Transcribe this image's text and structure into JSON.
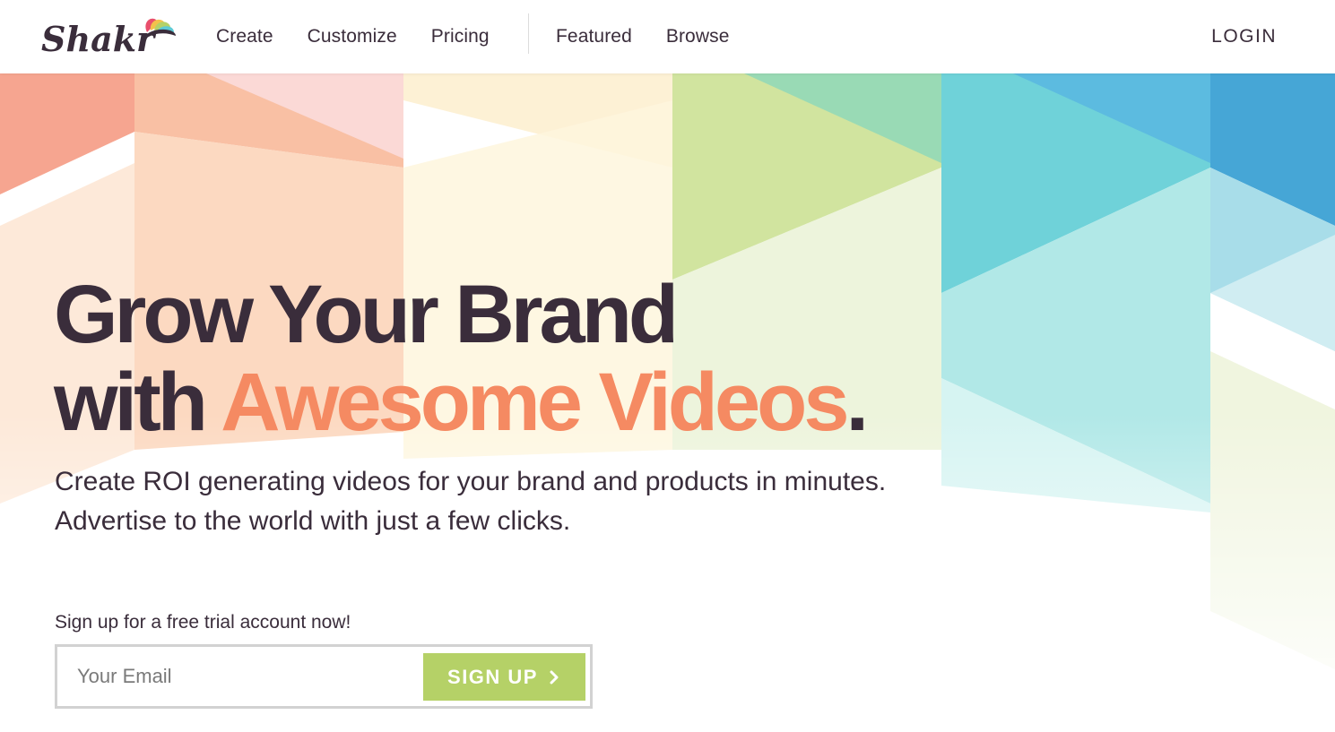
{
  "brand": {
    "logo_text": "Shakr",
    "logo_colors": [
      "#f58a62",
      "#f3c24c",
      "#b5d167",
      "#5ccad6",
      "#3aa0d6",
      "#e94f6c"
    ]
  },
  "nav": {
    "left": [
      "Create",
      "Customize",
      "Pricing"
    ],
    "right": [
      "Featured",
      "Browse"
    ],
    "login": "LOGIN"
  },
  "hero": {
    "headline_line1": "Grow Your Brand",
    "headline_line2_prefix": "with ",
    "headline_line2_accent": "Awesome Videos",
    "headline_line2_suffix": ".",
    "subtitle_line1": "Create ROI generating videos for your brand and products in minutes.",
    "subtitle_line2": "Advertise to the world with just a few clicks.",
    "cta_label": "Sign up for a free trial account now!",
    "email_placeholder": "Your Email",
    "signup_button": "SIGN UP",
    "signup_icon": "chevron-right-icon"
  },
  "colors": {
    "text": "#3a2d3b",
    "accent": "#f58a62",
    "button": "#b5d167",
    "input_border": "#d2d2d2"
  }
}
